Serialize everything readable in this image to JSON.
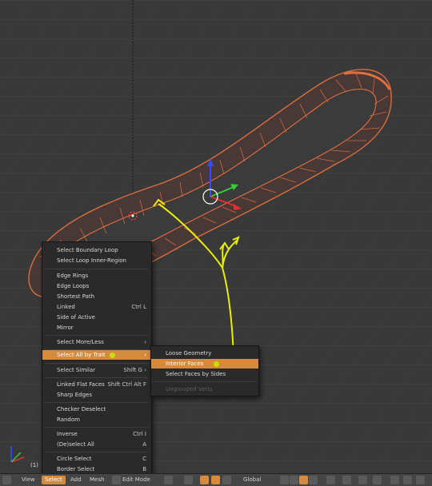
{
  "frame_label": "(1)",
  "menu": {
    "items": [
      {
        "label": "Select Boundary Loop",
        "shortcut": ""
      },
      {
        "label": "Select Loop Inner-Region",
        "shortcut": ""
      },
      {
        "label": "Edge Rings",
        "shortcut": ""
      },
      {
        "label": "Edge Loops",
        "shortcut": ""
      },
      {
        "label": "Shortest Path",
        "shortcut": ""
      },
      {
        "label": "Linked",
        "shortcut": "Ctrl L"
      },
      {
        "label": "Side of Active",
        "shortcut": ""
      },
      {
        "label": "Mirror",
        "shortcut": ""
      },
      {
        "label": "Select More/Less",
        "shortcut": "›"
      },
      {
        "label": "Select All by Trait",
        "shortcut": "›"
      },
      {
        "label": "Select Similar",
        "shortcut": "Shift G ›"
      },
      {
        "label": "Linked Flat Faces",
        "shortcut": "Shift Ctrl Alt F"
      },
      {
        "label": "Sharp Edges",
        "shortcut": ""
      },
      {
        "label": "Checker Deselect",
        "shortcut": ""
      },
      {
        "label": "Random",
        "shortcut": ""
      },
      {
        "label": "Inverse",
        "shortcut": "Ctrl I"
      },
      {
        "label": "(De)select All",
        "shortcut": "A"
      },
      {
        "label": "Circle Select",
        "shortcut": "C"
      },
      {
        "label": "Border Select",
        "shortcut": "B"
      }
    ]
  },
  "submenu": {
    "items": [
      {
        "label": "Loose Geometry"
      },
      {
        "label": "Interior Faces"
      },
      {
        "label": "Select Faces by Sides"
      },
      {
        "label": "Ungrouped Verts"
      }
    ]
  },
  "statusbar": {
    "view": "View",
    "select": "Select",
    "add": "Add",
    "mesh": "Mesh",
    "mode": "Edit Mode",
    "orientation": "Global"
  },
  "colors": {
    "accent": "#d68a3c",
    "mesh_edge": "#e07040",
    "annotation": "#e8f000"
  }
}
